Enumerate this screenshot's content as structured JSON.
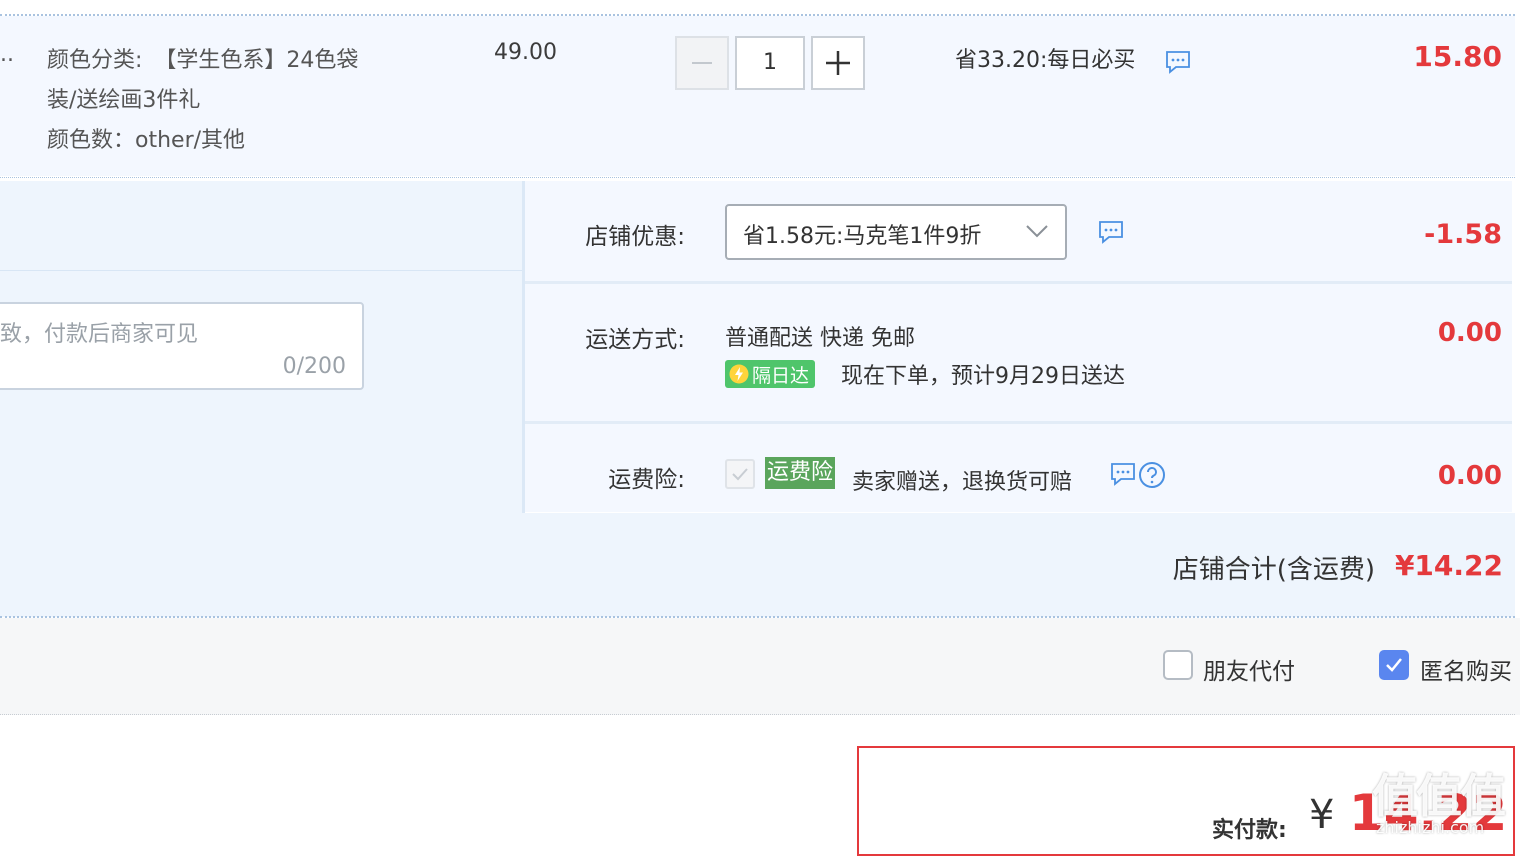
{
  "product": {
    "ellipsis": "..",
    "sku_label": "颜色分类:",
    "sku_value_line1": "【学生色系】24色袋",
    "sku_value_line2": "装/送绘画3件礼",
    "color_count": "颜色数：other/其他",
    "unit_price": "49.00",
    "quantity": "1",
    "promo": "省33.20:每日必买",
    "subtotal": "15.80"
  },
  "memo": {
    "placeholder_fragment": "致，付款后商家可见",
    "char_count": "0/200"
  },
  "shop_discount": {
    "label": "店铺优惠:",
    "selected": "省1.58元:马克笔1件9折",
    "amount": "-1.58"
  },
  "shipping": {
    "label": "运送方式:",
    "method": "普通配送 快递 免邮",
    "badge": "隔日达",
    "eta": "现在下单，预计9月29日送达",
    "amount": "0.00"
  },
  "insurance": {
    "label": "运费险:",
    "badge": "运费险",
    "text": "卖家赠送，退换货可赔",
    "amount": "0.00"
  },
  "shop_total": {
    "label": "店铺合计(含运费)",
    "amount": "¥14.22"
  },
  "options": {
    "friend_pay": "朋友代付",
    "anonymous": "匿名购买",
    "friend_pay_checked": false,
    "anonymous_checked": true
  },
  "payment": {
    "label": "实付款:",
    "currency": "¥",
    "amount": "14.22"
  },
  "watermark": {
    "logo": "值值值",
    "site": "zhizhizhi.com"
  },
  "colors": {
    "accent_red": "#e4393c",
    "checkbox_blue": "#5a86ef",
    "badge_green": "#5aa55c",
    "next_day_green": "#4fc56b"
  }
}
